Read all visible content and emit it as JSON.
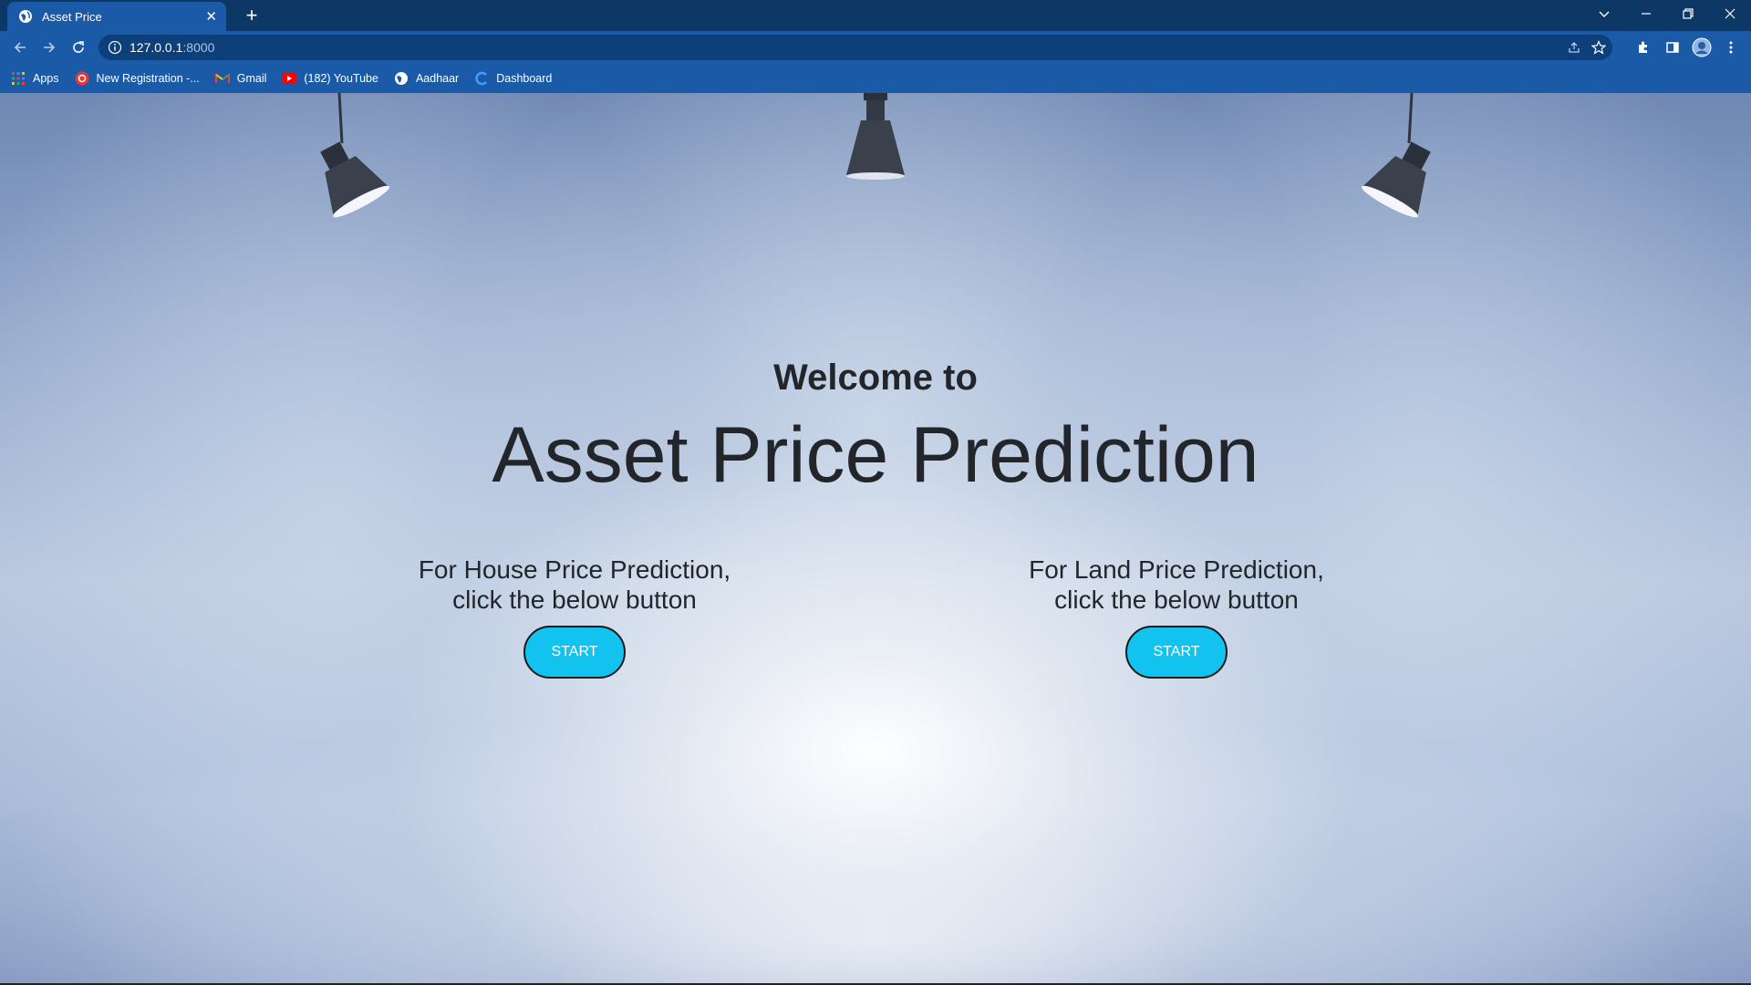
{
  "browser": {
    "tab_title": "Asset Price",
    "new_tab_label": "+",
    "close_label": "✕",
    "url_host": "127.0.0.1",
    "url_port": ":8000",
    "bookmarks": [
      {
        "label": "Apps",
        "icon": "apps-grid-icon"
      },
      {
        "label": "New Registration -...",
        "icon": "registration-icon"
      },
      {
        "label": "Gmail",
        "icon": "gmail-icon"
      },
      {
        "label": "(182) YouTube",
        "icon": "youtube-icon"
      },
      {
        "label": "Aadhaar",
        "icon": "globe-icon"
      },
      {
        "label": "Dashboard",
        "icon": "dashboard-icon"
      }
    ],
    "colors": {
      "tabstrip": "#0d3866",
      "toolbar": "#1a5aa6"
    }
  },
  "page": {
    "welcome": "Welcome to",
    "title": "Asset Price Prediction",
    "house": {
      "line1": "For House Price Prediction,",
      "line2": "click the below button",
      "button": "START"
    },
    "land": {
      "line1": "For Land Price Prediction,",
      "line2": "click the below button",
      "button": "START"
    },
    "colors": {
      "button": "#12c2ef",
      "text": "#22262b"
    }
  }
}
